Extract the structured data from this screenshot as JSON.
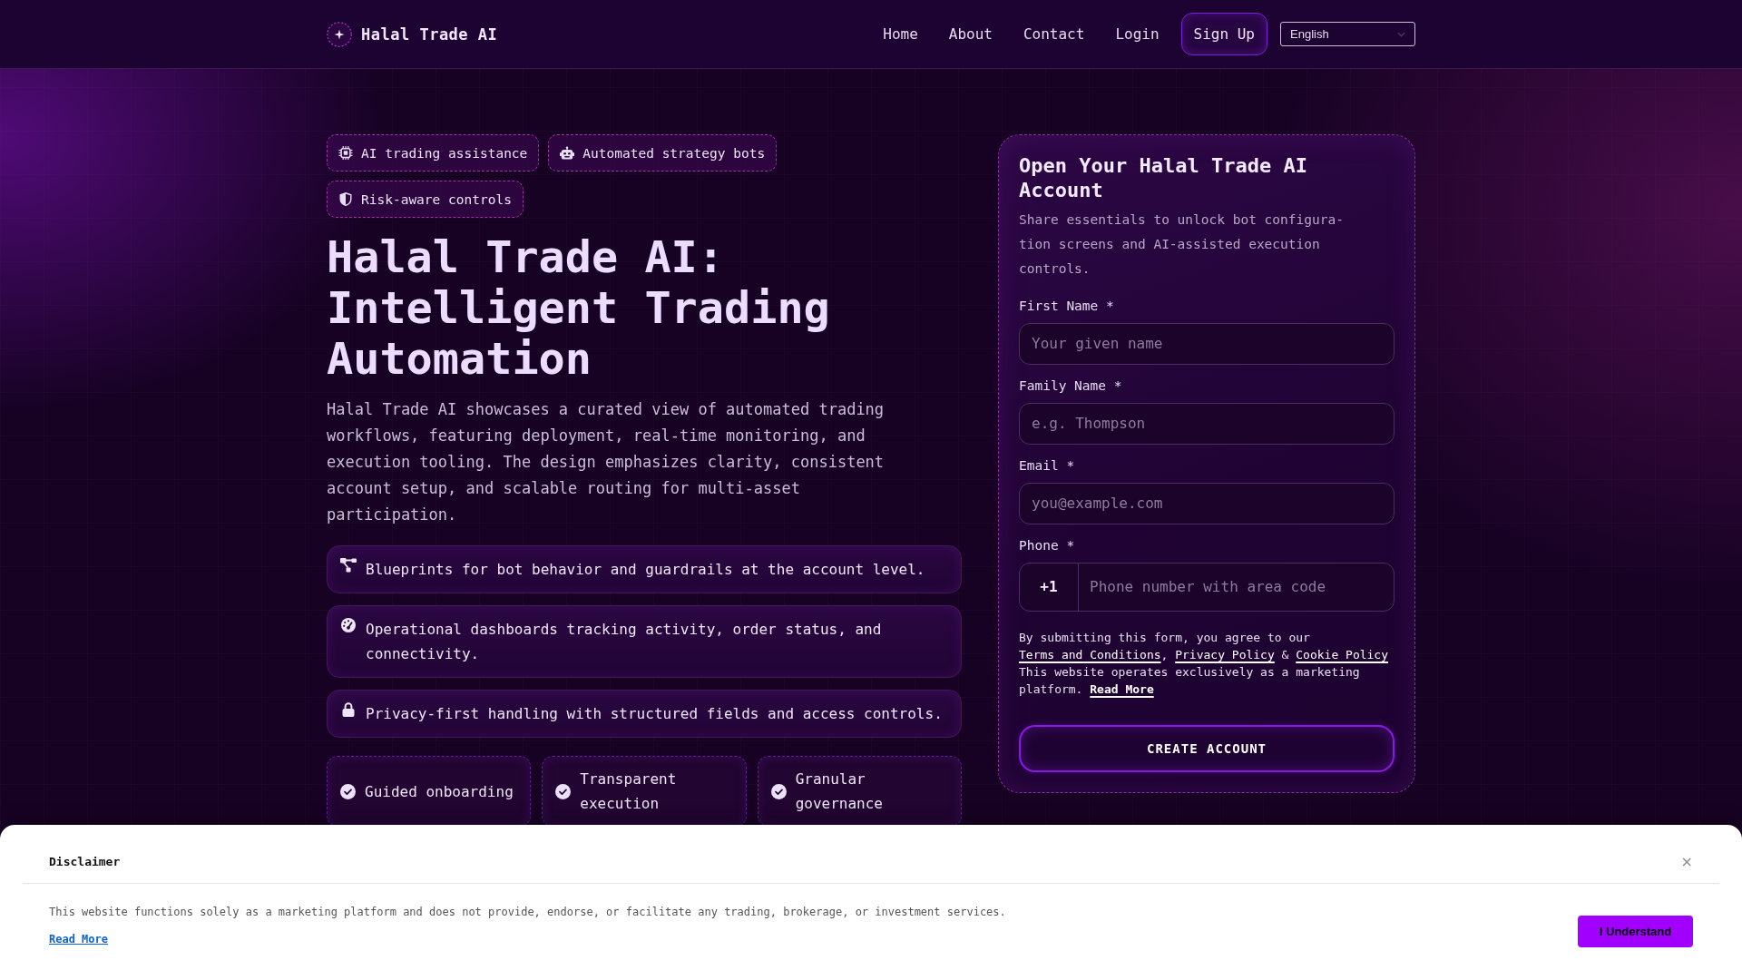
{
  "header": {
    "brand": "Halal Trade AI",
    "nav": [
      {
        "label": "Home"
      },
      {
        "label": "About"
      },
      {
        "label": "Contact"
      },
      {
        "label": "Login"
      }
    ],
    "signup": "Sign Up",
    "language": "English"
  },
  "hero": {
    "badges": [
      "AI trading assistance",
      "Automated strategy bots",
      "Risk-aware controls"
    ],
    "title": "Halal Trade AI: Intelligent Trading Automation",
    "description": "Halal Trade AI showcases a curated view of automated trading workflows, featuring deployment, real-time monitoring, and execution tooling. The design emphasizes clarity, consistent account setup, and scalable routing for multi-asset participation.",
    "features": [
      "Blueprints for bot behavior and guardrails at the account level.",
      "Operational dashboards tracking activity, order status, and connectivity.",
      "Privacy-first handling with structured fields and access controls."
    ],
    "highlights": [
      "Guided onboarding",
      "Transparent execution",
      "Granular governance"
    ]
  },
  "signup_form": {
    "title": "Open Your Halal Trade AI Account",
    "subtitle": "Share essentials to unlock bot configura-tion screens and AI-assisted execution controls.",
    "fields": [
      {
        "kind": "text",
        "label": "First Name *",
        "placeholder": "Your given name"
      },
      {
        "kind": "text",
        "label": "Family Name *",
        "placeholder": "e.g. Thompson"
      },
      {
        "kind": "email",
        "label": "Email *",
        "placeholder": "you@example.com"
      },
      {
        "kind": "phone",
        "label": "Phone *",
        "prefix": "+1",
        "placeholder": "Phone number with area code"
      }
    ],
    "consent": [
      {
        "kind": "text",
        "text": "By submitting this form, you agree to our "
      },
      {
        "kind": "link",
        "text": "Terms and Conditions"
      },
      {
        "kind": "text",
        "text": ", "
      },
      {
        "kind": "link",
        "text": "Privacy Policy"
      },
      {
        "kind": "text",
        "text": " & "
      },
      {
        "kind": "link",
        "text": "Cookie Policy"
      }
    ],
    "notice": [
      {
        "kind": "text",
        "text": "This website operates exclusively as a marketing platform. "
      },
      {
        "kind": "bold_link",
        "text": "Read More"
      }
    ],
    "submit": "CREATE ACCOUNT"
  },
  "disclaimer": {
    "title": "Disclaimer",
    "close": "×",
    "text": "This website functions solely as a marketing platform and does not provide, endorse, or facilitate any trading, brokerage, or investment services.",
    "link": "Read More",
    "button": "I Understand"
  }
}
